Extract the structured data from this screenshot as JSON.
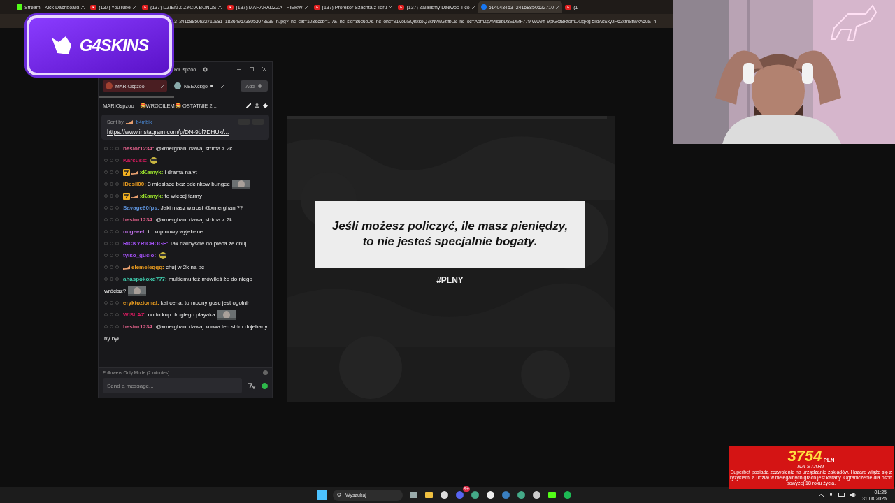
{
  "browser": {
    "tabs": [
      {
        "title": "Stream - Kick Dashboard",
        "kind": "kick",
        "selected": false
      },
      {
        "title": "(137) YouTube",
        "kind": "youtube",
        "selected": false
      },
      {
        "title": "(137) DZIEŃ Z ŻYCIA BONUS",
        "kind": "youtube",
        "selected": false
      },
      {
        "title": "(137) MAHARADZZA - PIERW",
        "kind": "youtube",
        "selected": false
      },
      {
        "title": "(137) Profesor Szachta z Toru",
        "kind": "youtube",
        "selected": false
      },
      {
        "title": "(137) Zalaliśmy Daewoo Tico",
        "kind": "youtube",
        "selected": false
      },
      {
        "title": "514043453_24168850622710",
        "kind": "facebook",
        "selected": true
      },
      {
        "title": "(1",
        "kind": "youtube",
        "selected": false
      }
    ],
    "url": "3_24168850622710981_1826496738053073939_n.jpg?_nc_cat=103&ccb=1-7&_nc_sid=86c6b0&_nc_ohc=91VoLGQnxkoQ7kNvwGzifbL&_nc_oc=AdmZgAVIsebD8EDMF779-WU9ff_9piGkz8RtomOOgRg-5lidAcSxyJH63xmStlwkA60&_n"
  },
  "logo": {
    "text": "G4SKINS"
  },
  "chat_window": {
    "title": "RIOspzoo",
    "tabs": [
      {
        "label": "MARIOspzoo",
        "selected": true,
        "live": false
      },
      {
        "label": "NEEXcsgo",
        "selected": false,
        "live": true
      }
    ],
    "add_button": "Add",
    "channel": {
      "name": "MARIOspzoo",
      "stream_title": "🤩WROCILEM🤩 OSTATNIE 2..."
    },
    "pinned": {
      "sent_by": "Sent by",
      "user": "b4mbik",
      "link": "https://www.instagram.com/p/DN-9bl7DHUk/..."
    },
    "messages": [
      {
        "user": "basior1234:",
        "color": "#e0608a",
        "text": "@xmerghani dawaj strima z 2k"
      },
      {
        "user": "Karcuss:",
        "color": "#d81b60",
        "emote": {
          "kind": "sticker"
        }
      },
      {
        "user": "xKamyk:",
        "color": "#9be22d",
        "text": "i drama na yt",
        "badges": [
          {
            "kind": "seven"
          },
          {
            "kind": "slipper"
          }
        ]
      },
      {
        "user": "iDesil00:",
        "color": "#f0a020",
        "text": "3 miesiace bez odcinkow bungee"
      },
      {
        "user": "xKamyk:",
        "color": "#9be22d",
        "text": "to wiecej farmy",
        "badges": [
          {
            "kind": "seven"
          },
          {
            "kind": "slipper"
          }
        ]
      },
      {
        "user": "Savage60fps:",
        "color": "#5b8fd6",
        "text": "Jaki masz wzrost @xmerghani??"
      },
      {
        "user": "basior1234:",
        "color": "#e0608a",
        "text": "@xmerghani dawaj strima z 2k"
      },
      {
        "user": "nugeeet:",
        "color": "#c070e8",
        "text": "to kup nowy wyjebane"
      },
      {
        "user": "RICKYRICHOGF:",
        "color": "#a050f0",
        "text": "Tak dalibyście do pieca że chuj"
      },
      {
        "user": "tylko_gucio:",
        "color": "#a050f0",
        "emote": {
          "kind": "sticker"
        }
      },
      {
        "user": "elemeleqqq:",
        "color": "#f0a020",
        "text": "chuj w 2k na pc",
        "badges": [
          {
            "kind": "slipper"
          }
        ]
      },
      {
        "user": "ahaspokoxd777:",
        "color": "#40d0b0",
        "text": "multiemu też mówiłeś że do niego wrócisz?"
      },
      {
        "user": "eryktoziomal:",
        "color": "#f0a020",
        "text": "kai cenat to mocny gosc jest ogolnir"
      },
      {
        "user": "WISLAZ:",
        "color": "#d81b60",
        "text": "no to kup drugiego playaka"
      },
      {
        "user": "basior1234:",
        "color": "#e0608a",
        "text": "@xmerghani dawaj kurwa ten strim dojebany by był"
      }
    ],
    "mode": "Followers Only Mode (2 minutes)",
    "input": {
      "placeholder": "Send a message..."
    }
  },
  "stage": {
    "quote": "Jeśli możesz policzyć, ile masz pieniędzy,\nto nie jesteś specjalnie bogaty.",
    "hashtag": "#PLNY"
  },
  "ad": {
    "amount": "3754",
    "currency": "PLN",
    "tagline": "NA START",
    "disclaimer": "Superbet posiada zezwolenie na urządzanie zakładów. Hazard wiąże się z ryzykiem, a udział w nielegalnych grach jest karany. Ograniczenie dla osób powyżej 18 roku życia."
  },
  "taskbar": {
    "search": "Wyszukaj",
    "apps": [
      {
        "kind": "files"
      },
      {
        "kind": "folder"
      },
      {
        "kind": "logi"
      },
      {
        "kind": "discord",
        "badge": "9+"
      },
      {
        "kind": "chrome"
      },
      {
        "kind": "steelseries"
      },
      {
        "kind": "steam"
      },
      {
        "kind": "chrome"
      },
      {
        "kind": "obs"
      },
      {
        "kind": "kick"
      },
      {
        "kind": "spotify"
      }
    ],
    "time": "01:25",
    "date": "31.08.2025"
  }
}
